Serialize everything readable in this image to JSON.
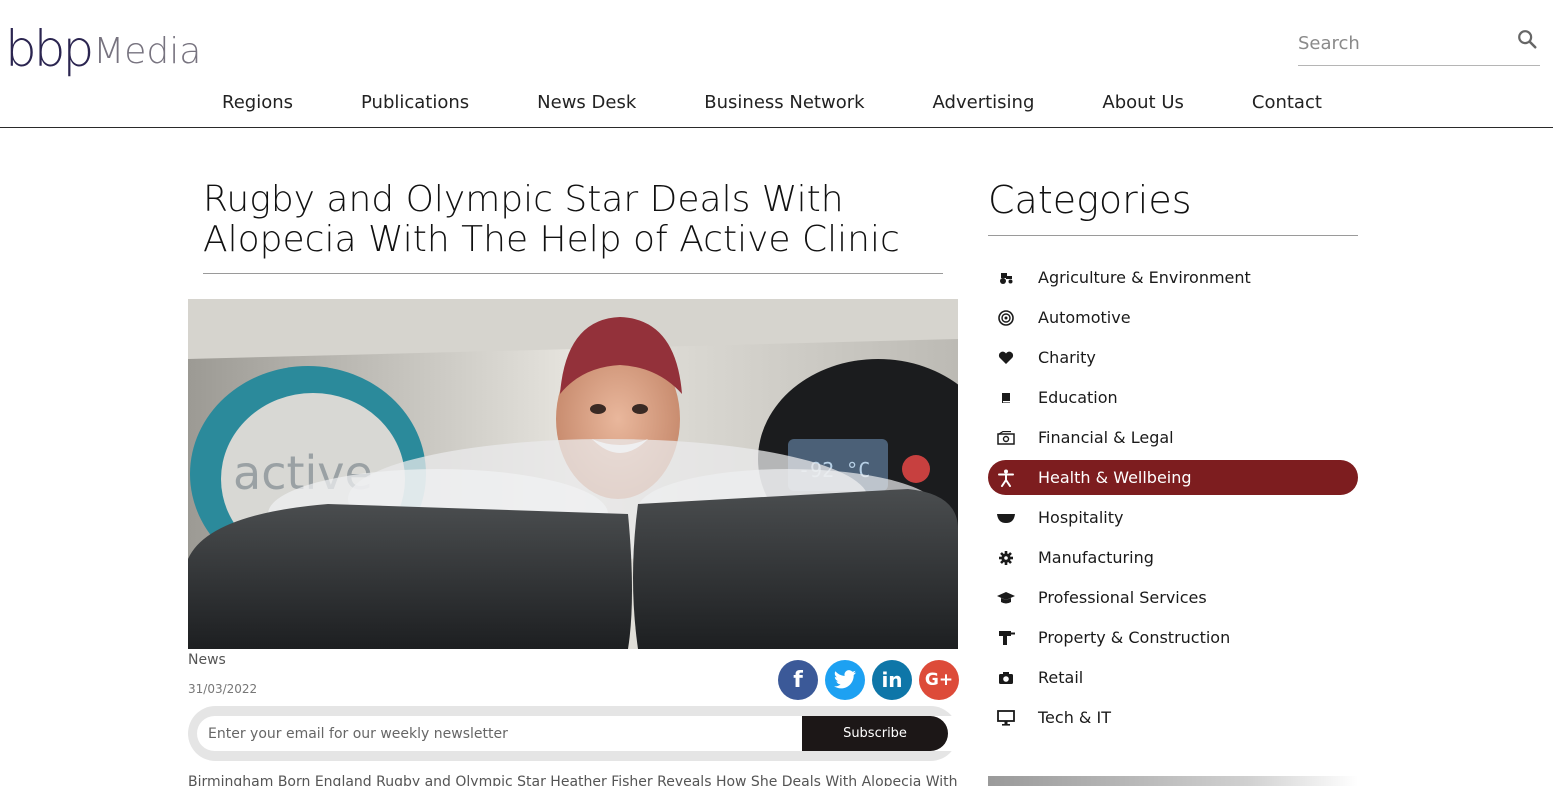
{
  "brand": {
    "logo_main": "bbp",
    "logo_sub": "Media"
  },
  "search": {
    "placeholder": "Search"
  },
  "nav": {
    "items": [
      "Regions",
      "Publications",
      "News Desk",
      "Business Network",
      "Advertising",
      "About Us",
      "Contact"
    ]
  },
  "article": {
    "title": "Rugby and Olympic Star Deals With Alopecia With The Help of Active Clinic",
    "category": "News",
    "date": "31/03/2022",
    "excerpt": "Birmingham Born England Rugby and Olympic Star Heather Fisher Reveals How She Deals With Alopecia With The",
    "hero_text": {
      "sign": "active",
      "display": "-92 °C"
    }
  },
  "share": {
    "facebook": "f",
    "linkedin": "in",
    "google": "G+"
  },
  "newsletter": {
    "placeholder": "Enter your email for our weekly newsletter",
    "button": "Subscribe"
  },
  "sidebar": {
    "heading": "Categories",
    "items": [
      {
        "label": "Agriculture & Environment",
        "icon": "tractor-icon"
      },
      {
        "label": "Automotive",
        "icon": "wheel-icon"
      },
      {
        "label": "Charity",
        "icon": "heart-icon"
      },
      {
        "label": "Education",
        "icon": "book-icon"
      },
      {
        "label": "Financial & Legal",
        "icon": "money-icon"
      },
      {
        "label": "Health & Wellbeing",
        "icon": "person-icon",
        "active": true
      },
      {
        "label": "Hospitality",
        "icon": "bowl-icon"
      },
      {
        "label": "Manufacturing",
        "icon": "cog-icon"
      },
      {
        "label": "Professional Services",
        "icon": "graduation-cap-icon"
      },
      {
        "label": "Property & Construction",
        "icon": "drill-icon"
      },
      {
        "label": "Retail",
        "icon": "camera-icon"
      },
      {
        "label": "Tech & IT",
        "icon": "monitor-icon"
      }
    ],
    "active_color": "#7d1d1f"
  }
}
